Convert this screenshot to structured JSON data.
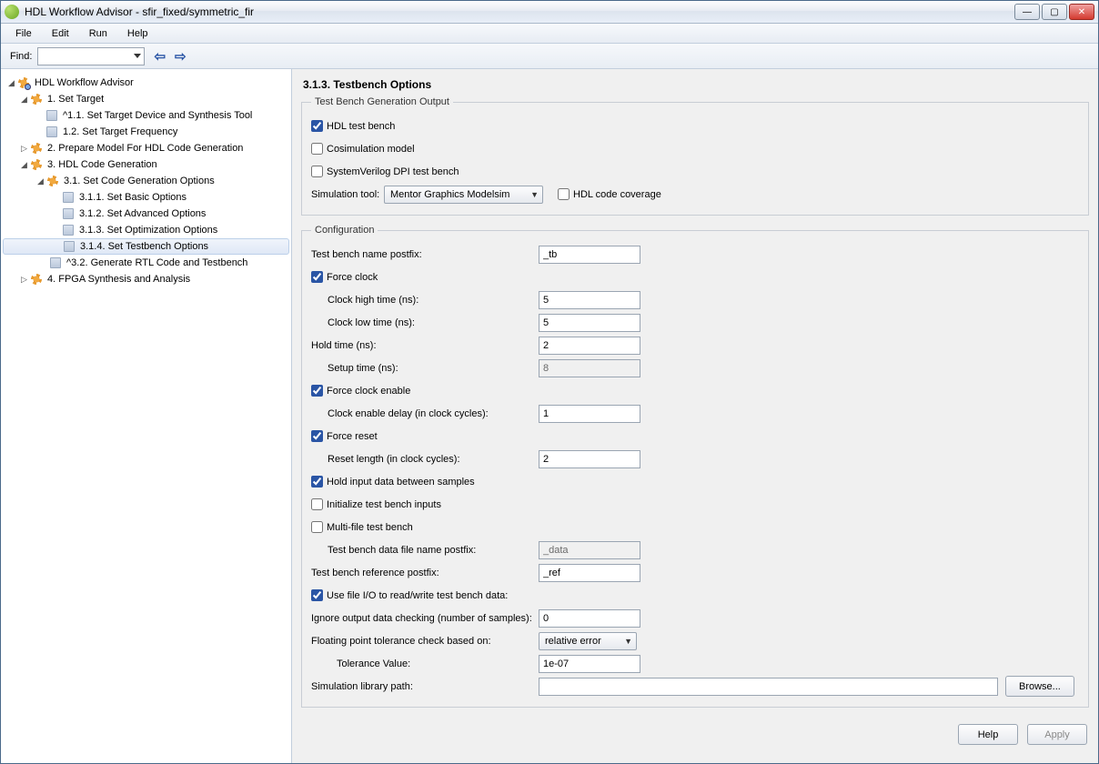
{
  "titlebar": {
    "text": "HDL Workflow Advisor - sfir_fixed/symmetric_fir"
  },
  "menu": {
    "file": "File",
    "edit": "Edit",
    "run": "Run",
    "help": "Help"
  },
  "toolbar": {
    "find_label": "Find:",
    "find_value": ""
  },
  "tree": {
    "root": "HDL Workflow Advisor",
    "n1": "1. Set Target",
    "n1_1": "^1.1. Set Target Device and Synthesis Tool",
    "n1_2": "1.2. Set Target Frequency",
    "n2": "2. Prepare Model For HDL Code Generation",
    "n3": "3. HDL Code Generation",
    "n3_1": "3.1. Set Code Generation Options",
    "n3_1_1": "3.1.1. Set Basic Options",
    "n3_1_2": "3.1.2. Set Advanced Options",
    "n3_1_3": "3.1.3. Set Optimization Options",
    "n3_1_4": "3.1.4. Set Testbench Options",
    "n3_2": "^3.2. Generate RTL Code and Testbench",
    "n4": "4. FPGA Synthesis and Analysis"
  },
  "panel": {
    "title": "3.1.3. Testbench Options",
    "group1": {
      "legend": "Test Bench Generation Output",
      "hdl_tb": "HDL test bench",
      "cosim": "Cosimulation model",
      "sv_dpi": "SystemVerilog DPI test bench",
      "sim_tool_label": "Simulation tool:",
      "sim_tool_value": "Mentor Graphics Modelsim",
      "hdl_cov": "HDL code coverage"
    },
    "group2": {
      "legend": "Configuration",
      "tb_postfix_label": "Test bench name postfix:",
      "tb_postfix": "_tb",
      "force_clock": "Force clock",
      "clk_high_label": "Clock high time (ns):",
      "clk_high": "5",
      "clk_low_label": "Clock low time (ns):",
      "clk_low": "5",
      "hold_label": "Hold time (ns):",
      "hold": "2",
      "setup_label": "Setup time (ns):",
      "setup": "8",
      "force_clk_en": "Force clock enable",
      "clk_en_delay_label": "Clock enable delay (in clock cycles):",
      "clk_en_delay": "1",
      "force_reset": "Force reset",
      "reset_len_label": "Reset length (in clock cycles):",
      "reset_len": "2",
      "hold_input": "Hold input data between samples",
      "init_tb": "Initialize test bench inputs",
      "multi_file": "Multi-file test bench",
      "data_postfix_label": "Test bench data file name postfix:",
      "data_postfix": "_data",
      "ref_postfix_label": "Test bench reference postfix:",
      "ref_postfix": "_ref",
      "use_fileio": "Use file I/O to read/write test bench data:",
      "ignore_label": "Ignore output data checking (number of samples):",
      "ignore": "0",
      "fptol_label": "Floating point tolerance check based on:",
      "fptol_value": "relative error",
      "tol_val_label": "Tolerance Value:",
      "tol_val": "1e-07",
      "libpath_label": "Simulation library path:",
      "libpath": "",
      "browse": "Browse..."
    }
  },
  "footer": {
    "help": "Help",
    "apply": "Apply"
  }
}
